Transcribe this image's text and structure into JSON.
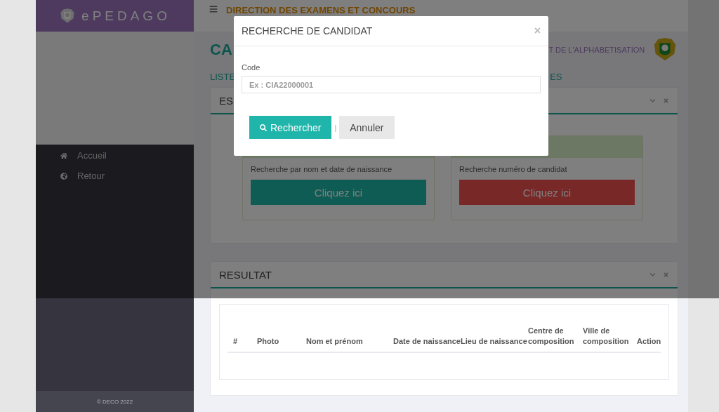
{
  "sidebar": {
    "brand": "ePEDAGO",
    "menu": [
      {
        "label": "Accueil"
      },
      {
        "label": "Retour"
      }
    ],
    "footer": "© DECO 2022"
  },
  "topbar": {
    "title": "DIRECTION DES EXAMENS ET CONCOURS"
  },
  "page": {
    "title": "CA",
    "ministry": "T DE L'ALPHABETISATION",
    "subtitle_left": "LISTE",
    "subtitle_right": "ES"
  },
  "search_panel": {
    "title": "ES",
    "cards": [
      {
        "text": "Recherche par nom et date de naissance",
        "button": "Cliquez ici",
        "kind": "primary"
      },
      {
        "text": "Recherche numéro de candidat",
        "button": "Cliquez ici",
        "kind": "danger"
      }
    ]
  },
  "results_panel": {
    "title": "RESULTAT",
    "table": {
      "columns": [
        "#",
        "Photo",
        "Nom et prénom",
        "Date de naissance",
        "Lieu de naissance",
        "Centre de composition",
        "Ville de composition",
        "Action"
      ]
    }
  },
  "modal": {
    "title": "RECHERCHE DE CANDIDAT",
    "close": "×",
    "field": {
      "label": "Code",
      "placeholder": "Ex : CIA22000001"
    },
    "separator": "|",
    "buttons": [
      {
        "label": "Rechercher",
        "kind": "primary"
      },
      {
        "label": "Annuler",
        "kind": "secondary"
      }
    ]
  }
}
